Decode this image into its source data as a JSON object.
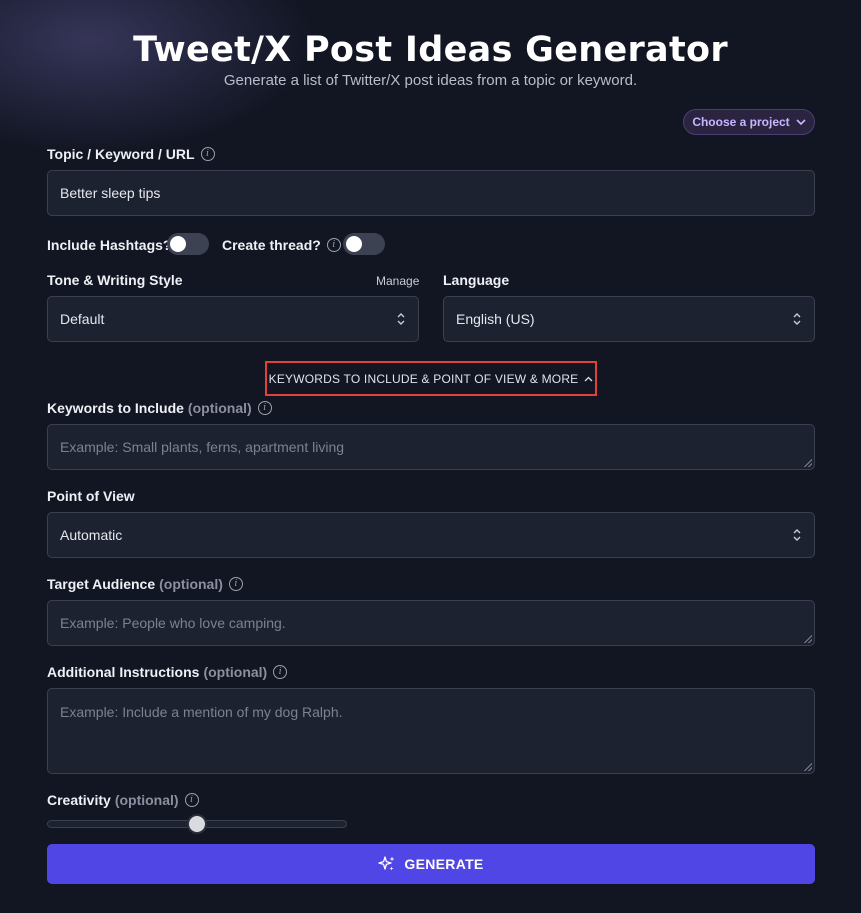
{
  "header": {
    "title": "Tweet/X Post Ideas Generator",
    "subtitle": "Generate a list of Twitter/X post ideas from a topic or keyword."
  },
  "project": {
    "label": "Choose a project"
  },
  "topic": {
    "label": "Topic / Keyword / URL",
    "value": "Better sleep tips"
  },
  "hashtags": {
    "label": "Include Hashtags?",
    "enabled": false
  },
  "thread": {
    "label": "Create thread?",
    "enabled": false
  },
  "tone": {
    "label": "Tone & Writing Style",
    "manage_label": "Manage",
    "selected": "Default"
  },
  "language": {
    "label": "Language",
    "selected": "English (US)"
  },
  "advanced": {
    "label": "KEYWORDS TO INCLUDE & POINT OF VIEW & MORE",
    "expanded": true
  },
  "keywords": {
    "label": "Keywords to Include",
    "optional": "(optional)",
    "placeholder": "Example: Small plants, ferns, apartment living"
  },
  "pov": {
    "label": "Point of View",
    "selected": "Automatic"
  },
  "audience": {
    "label": "Target Audience",
    "optional": "(optional)",
    "placeholder": "Example: People who love camping."
  },
  "instructions": {
    "label": "Additional Instructions",
    "optional": "(optional)",
    "placeholder": "Example: Include a mention of my dog Ralph."
  },
  "creativity": {
    "label": "Creativity",
    "optional": "(optional)",
    "value": 0.5
  },
  "generate": {
    "label": "GENERATE"
  },
  "colors": {
    "accent": "#4f46e5",
    "highlight": "#e2413b",
    "background": "#121623"
  }
}
